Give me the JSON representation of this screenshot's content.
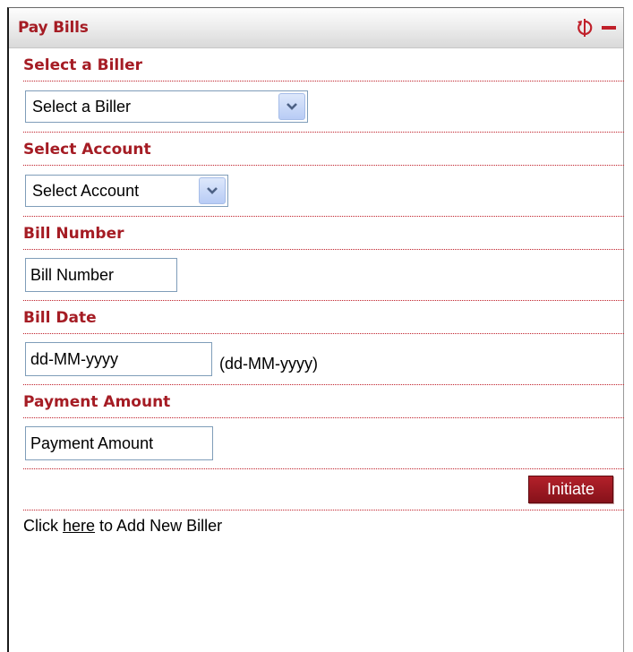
{
  "widget": {
    "title": "Pay Bills",
    "refresh_icon": "refresh-icon",
    "minimize_icon": "minimize-icon",
    "accent_color": "#a51c24"
  },
  "form": {
    "biller": {
      "label": "Select a Biller",
      "selected": "Select a Biller"
    },
    "account": {
      "label": "Select Account",
      "selected": "Select Account"
    },
    "bill_number": {
      "label": "Bill Number",
      "placeholder": "Bill Number"
    },
    "bill_date": {
      "label": "Bill Date",
      "placeholder": "dd-MM-yyyy",
      "format_hint": "(dd-MM-yyyy)"
    },
    "payment_amount": {
      "label": "Payment Amount",
      "placeholder": "Payment Amount"
    },
    "initiate_label": "Initiate"
  },
  "footer": {
    "prefix": "Click ",
    "link": "here",
    "suffix": " to Add New Biller"
  }
}
